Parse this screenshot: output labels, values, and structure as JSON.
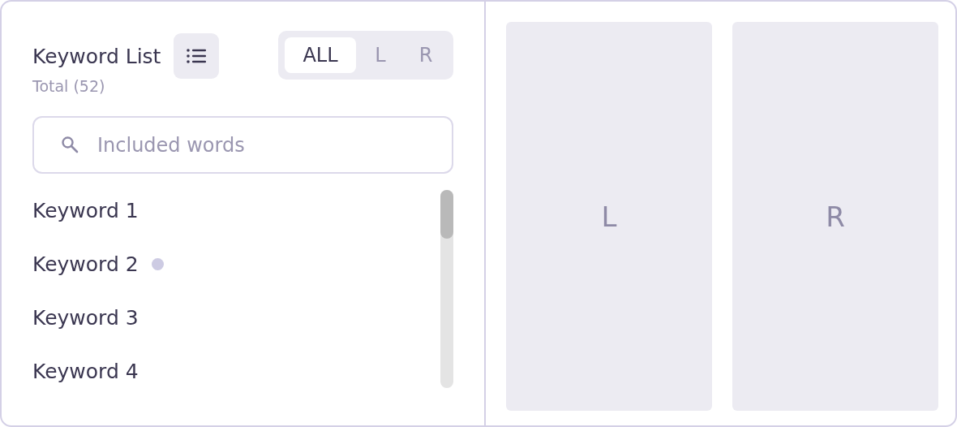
{
  "keyword_panel": {
    "title": "Keyword List",
    "total": "Total (52)",
    "filter_tabs": [
      {
        "label": "ALL",
        "selected": true
      },
      {
        "label": "L",
        "selected": false
      },
      {
        "label": "R",
        "selected": false
      }
    ]
  },
  "search": {
    "placeholder": "Included words"
  },
  "keywords": [
    {
      "label": "Keyword 1",
      "dot": false
    },
    {
      "label": "Keyword 2",
      "dot": true
    },
    {
      "label": "Keyword 3",
      "dot": false
    },
    {
      "label": "Keyword 4",
      "dot": false
    }
  ],
  "panels": [
    {
      "label": "L"
    },
    {
      "label": "R"
    }
  ]
}
